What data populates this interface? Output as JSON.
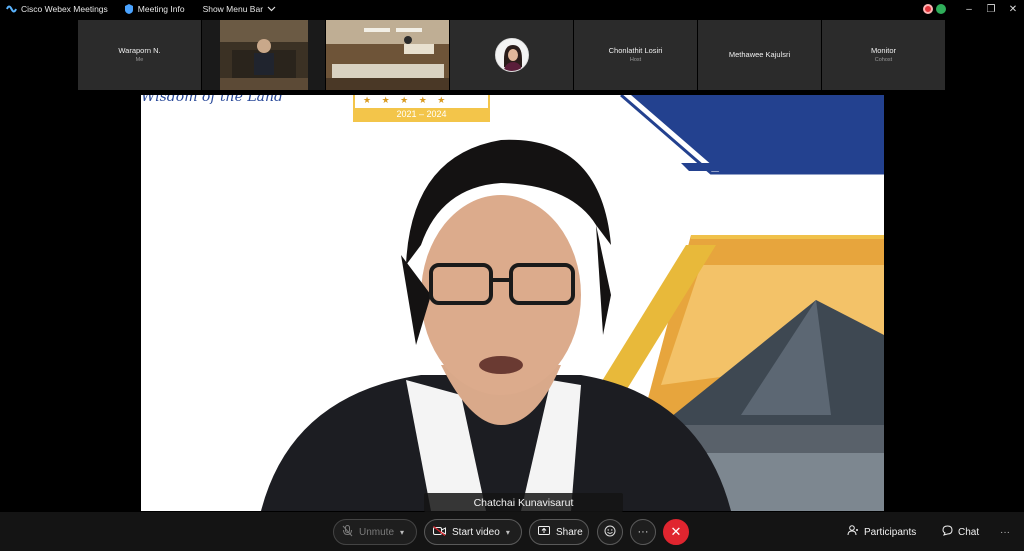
{
  "titlebar": {
    "app_name": "Cisco Webex Meetings",
    "meeting_info": "Meeting Info",
    "show_menu": "Show Menu Bar",
    "minimize": "–",
    "restore": "❐",
    "close": "✕"
  },
  "participants": [
    {
      "name": "Waraporn N.",
      "role": "Me"
    },
    {
      "name": "",
      "role": ""
    },
    {
      "name": "",
      "role": ""
    },
    {
      "name": "",
      "role": ""
    },
    {
      "name": "Chonlathit Losiri",
      "role": "Host"
    },
    {
      "name": "Methawee Kajulsri",
      "role": ""
    },
    {
      "name": "Monitor",
      "role": "Cohost"
    }
  ],
  "slide": {
    "script_text": "Wisdom of the Land",
    "years": "2021 – 2024",
    "stars": "★ ★ ★ ★ ★"
  },
  "speaker": {
    "name": "Chatchai Kunavisarut"
  },
  "controls": {
    "unmute": "Unmute",
    "start_video": "Start video",
    "share": "Share",
    "more": "···",
    "end": "✕",
    "participants": "Participants",
    "chat": "Chat",
    "overflow": "···"
  },
  "colors": {
    "accent_red": "#e0252f",
    "slide_blue": "#1f3a93",
    "slide_gold": "#e8b93a"
  }
}
